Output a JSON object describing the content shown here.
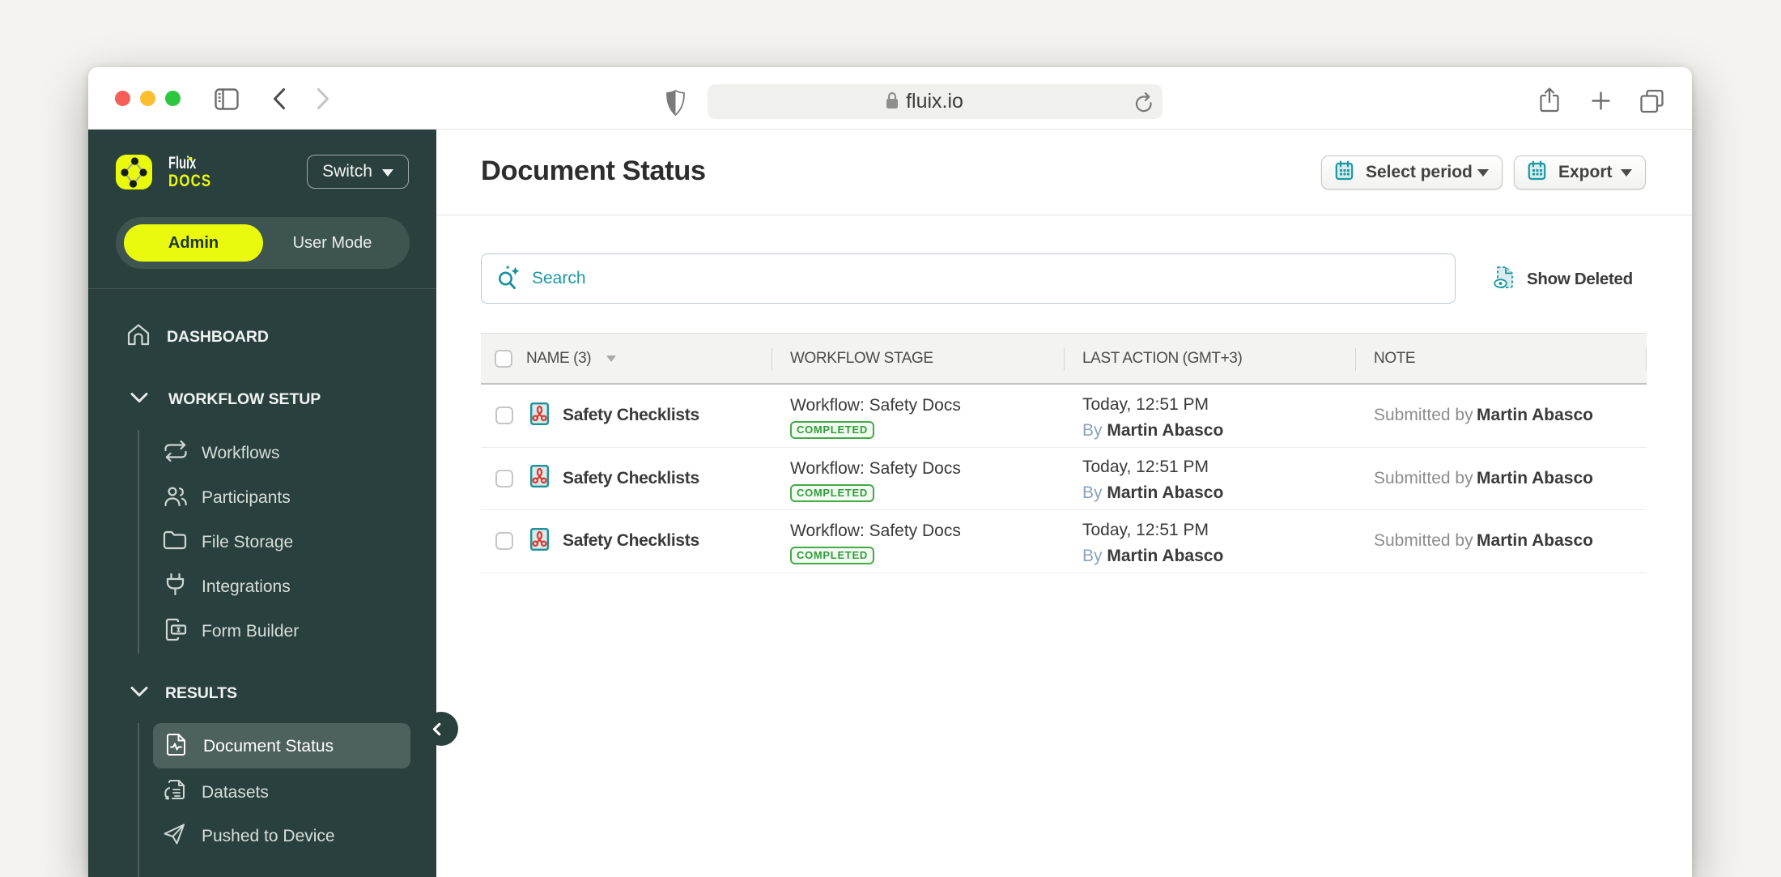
{
  "browser": {
    "url": "fluix.io",
    "traffic_lights": {
      "close": "#f65f57",
      "minimize": "#fbbe2f",
      "zoom": "#2dc63f"
    }
  },
  "sidebar": {
    "brand": {
      "name": "Fluix",
      "product": "DOCS"
    },
    "switch_label": "Switch",
    "mode_toggle": {
      "active": "Admin",
      "inactive": "User Mode"
    },
    "dashboard": {
      "label": "DASHBOARD"
    },
    "groups": [
      {
        "label": "WORKFLOW SETUP",
        "items": [
          {
            "label": "Workflows"
          },
          {
            "label": "Participants"
          },
          {
            "label": "File Storage"
          },
          {
            "label": "Integrations"
          },
          {
            "label": "Form Builder"
          }
        ]
      },
      {
        "label": "RESULTS",
        "items": [
          {
            "label": "Document Status",
            "selected": true
          },
          {
            "label": "Datasets"
          },
          {
            "label": "Pushed to Device"
          }
        ]
      }
    ]
  },
  "main": {
    "title": "Document Status",
    "toolbar": {
      "select_period_label": "Select period",
      "export_label": "Export"
    },
    "search": {
      "placeholder": "Search"
    },
    "show_deleted_label": "Show Deleted",
    "table": {
      "columns": {
        "name": "NAME (3)",
        "stage": "WORKFLOW STAGE",
        "last_action": "LAST ACTION (GMT+3)",
        "note": "NOTE"
      },
      "rows": [
        {
          "name": "Safety Checklists",
          "workflow": "Workflow: Safety Docs",
          "status": "COMPLETED",
          "time": "Today, 12:51 PM",
          "by_prefix": "By",
          "by_name": "Martin Abasco",
          "note_prefix": "Submitted by",
          "note_name": "Martin Abasco"
        },
        {
          "name": "Safety Checklists",
          "workflow": "Workflow: Safety Docs",
          "status": "COMPLETED",
          "time": "Today, 12:51 PM",
          "by_prefix": "By",
          "by_name": "Martin Abasco",
          "note_prefix": "Submitted by",
          "note_name": "Martin Abasco"
        },
        {
          "name": "Safety Checklists",
          "workflow": "Workflow: Safety Docs",
          "status": "COMPLETED",
          "time": "Today, 12:51 PM",
          "by_prefix": "By",
          "by_name": "Martin Abasco",
          "note_prefix": "Submitted by",
          "note_name": "Martin Abasco"
        }
      ]
    }
  },
  "colors": {
    "sidebar_bg": "#2a403e",
    "accent_yellow": "#e9fa0c",
    "accent_teal": "#1d98a3",
    "badge_green": "#2f9e37"
  }
}
